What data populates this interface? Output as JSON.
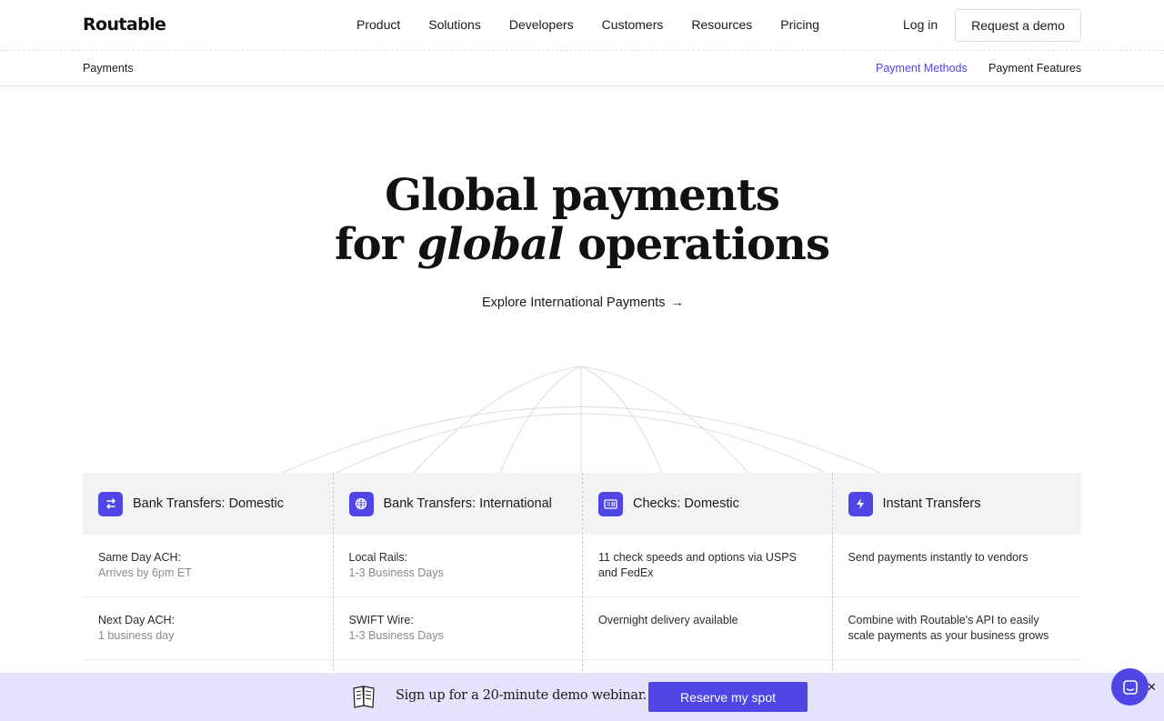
{
  "brand": {
    "logo": "Routable",
    "accent": "#4f46e5"
  },
  "nav": {
    "items": [
      "Product",
      "Solutions",
      "Developers",
      "Customers",
      "Resources",
      "Pricing"
    ],
    "login": "Log in",
    "demo": "Request a demo"
  },
  "subnav": {
    "section": "Payments",
    "links": [
      "Payment Methods",
      "Payment Features"
    ],
    "active": "Payment Methods"
  },
  "hero": {
    "line1": "Global payments",
    "line2_pre": "for ",
    "line2_em": "global",
    "line2_post": " operations",
    "cta": "Explore International Payments",
    "cta_arrow": "→"
  },
  "cards": [
    {
      "icon": "arrows-exchange-icon",
      "title": "Bank Transfers: Domestic",
      "rows": [
        {
          "label": "Same Day ACH:",
          "sub": "Arrives by 6pm ET"
        },
        {
          "label": "Next Day ACH:",
          "sub": "1 business day"
        }
      ]
    },
    {
      "icon": "globe-icon",
      "title": "Bank Transfers: International",
      "rows": [
        {
          "label": "Local Rails:",
          "sub": "1-3 Business Days"
        },
        {
          "label": "SWIFT Wire:",
          "sub": "1-3 Business Days"
        }
      ]
    },
    {
      "icon": "check-card-icon",
      "title": "Checks: Domestic",
      "rows": [
        {
          "label": "11 check speeds and options via USPS and FedEx",
          "sub": ""
        },
        {
          "label": "Overnight delivery available",
          "sub": ""
        }
      ]
    },
    {
      "icon": "lightning-icon",
      "title": "Instant Transfers",
      "rows": [
        {
          "label": "Send payments instantly to vendors",
          "sub": ""
        },
        {
          "label": "Combine with Routable's API to easily scale payments as your business grows",
          "sub": ""
        }
      ]
    }
  ],
  "banner": {
    "text": "Sign up for a 20-minute demo webinar.",
    "button": "Reserve my spot",
    "background": "#e4e3fb"
  },
  "chat": {
    "icon": "chat-icon",
    "close": "✕"
  }
}
